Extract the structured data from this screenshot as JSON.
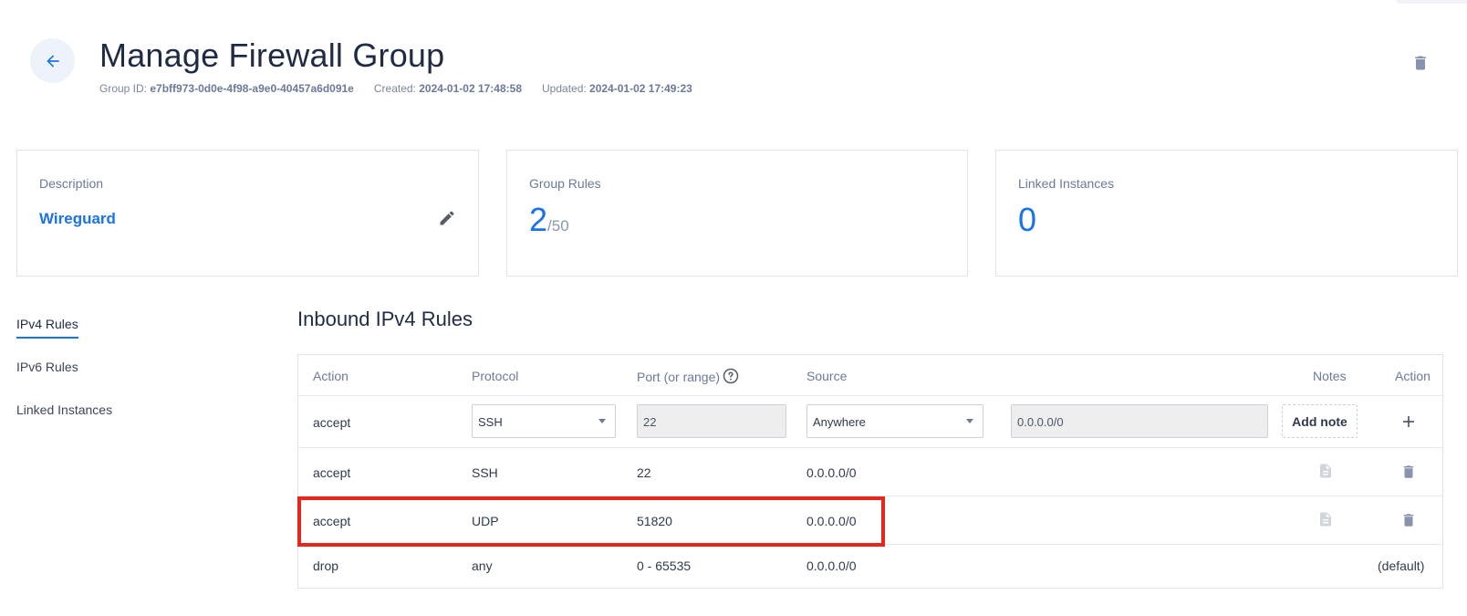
{
  "header": {
    "title": "Manage Firewall Group",
    "group_id_label": "Group ID:",
    "group_id": "e7bff973-0d0e-4f98-a9e0-40457a6d091e",
    "created_label": "Created:",
    "created": "2024-01-02 17:48:58",
    "updated_label": "Updated:",
    "updated": "2024-01-02 17:49:23"
  },
  "cards": {
    "description": {
      "label": "Description",
      "value": "Wireguard"
    },
    "group_rules": {
      "label": "Group Rules",
      "count": "2",
      "max": "/50"
    },
    "linked_instances": {
      "label": "Linked Instances",
      "count": "0"
    }
  },
  "sidebar": {
    "items": [
      {
        "label": "IPv4 Rules",
        "active": true
      },
      {
        "label": "IPv6 Rules",
        "active": false
      },
      {
        "label": "Linked Instances",
        "active": false
      }
    ]
  },
  "section": {
    "title": "Inbound IPv4 Rules"
  },
  "table": {
    "headers": {
      "action": "Action",
      "protocol": "Protocol",
      "port": "Port (or range)",
      "source": "Source",
      "notes": "Notes",
      "action_right": "Action"
    },
    "new_rule": {
      "action": "accept",
      "protocol": "SSH",
      "port": "22",
      "source": "Anywhere",
      "source_ip": "0.0.0.0/0",
      "add_note": "Add note"
    },
    "rows": [
      {
        "action": "accept",
        "protocol": "SSH",
        "port": "22",
        "source": "0.0.0.0/0"
      },
      {
        "action": "accept",
        "protocol": "UDP",
        "port": "51820",
        "source": "0.0.0.0/0"
      },
      {
        "action": "drop",
        "protocol": "any",
        "port": "0 - 65535",
        "source": "0.0.0.0/0",
        "note": "(default)"
      }
    ]
  },
  "colors": {
    "accent": "#1a73e8",
    "highlight": "#e8271c",
    "icon_gray": "#8a93ad"
  }
}
